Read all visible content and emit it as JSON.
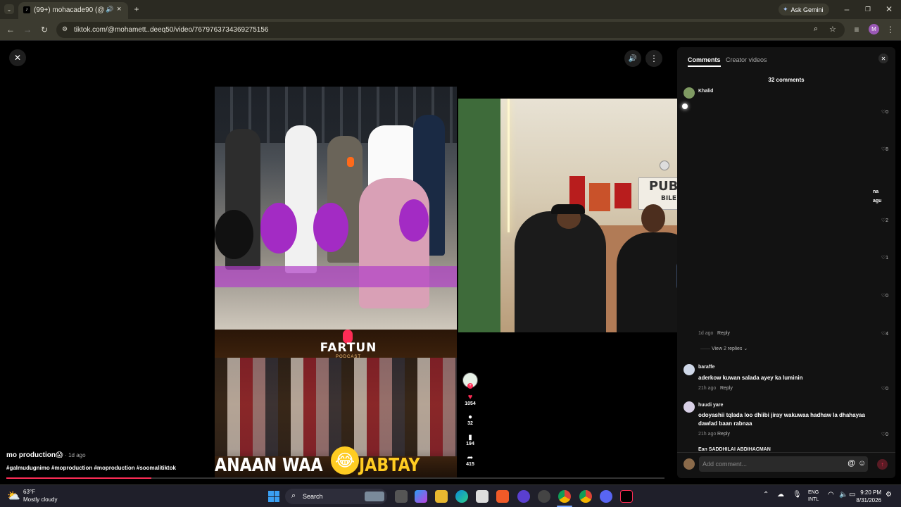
{
  "browser": {
    "tab_title": "(99+) mohacade90 (@moh",
    "new_tab": "+",
    "ask_gemini": "Ask Gemini",
    "url": "tiktok.com/@mohamett..deeq50/video/7679763734369275156",
    "profile_initial": "M"
  },
  "video": {
    "top_caption": "FARTUN",
    "top_caption_sub": "PODCAST",
    "bottom_text_left": "ANAAN WAA",
    "bottom_text_right": "JABTAY CAA",
    "tv_logo": "PUBG",
    "tv_logo_sub": "BILE"
  },
  "actions": {
    "likes": "1054",
    "comments": "32",
    "saves": "194",
    "shares": "415"
  },
  "author": {
    "name": "mo production",
    "emoji": "😱",
    "age": "· 1d ago",
    "hashtags": "#galmudugnimo #moproduction #moproduction #soomalitiktok"
  },
  "panel": {
    "tab_comments": "Comments",
    "tab_creator": "Creator videos",
    "count": "32 comments",
    "add_placeholder": "Add comment...",
    "partial_side_1": "na",
    "partial_side_2": "agu",
    "comments": [
      {
        "name": "Khalid",
        "likes": "0"
      },
      {
        "likes": "8"
      },
      {
        "likes": "2"
      },
      {
        "likes": "1"
      },
      {
        "likes": "0"
      },
      {
        "meta": "1d ago",
        "reply": "Reply",
        "likes": "4"
      }
    ],
    "view_replies": "View 2 replies",
    "c2": {
      "name": "baraffe",
      "text": "aderkow kuwan salada ayey ka luminin",
      "meta": "21h ago",
      "reply": "Reply",
      "likes": "0"
    },
    "c3": {
      "name": "huudi yare",
      "text": "odoyashii tqlada loo dhiibi jiray wakuwaa hadhaw la dhahayaa dawlad baan rabnaa",
      "meta": "21h ago",
      "reply": "Reply",
      "likes": "0"
    },
    "c4_name": "Ean SADDHILAI ABDIHACMAN"
  },
  "taskbar": {
    "temp": "63°F",
    "weather": "Mostly cloudy",
    "search": "Search",
    "lang1": "ENG",
    "lang2": "INTL",
    "time": "9:20 PM",
    "date": "8/31/2026"
  },
  "colors": {
    "accent_red": "#fe2c55",
    "panel_bg": "#121212"
  }
}
